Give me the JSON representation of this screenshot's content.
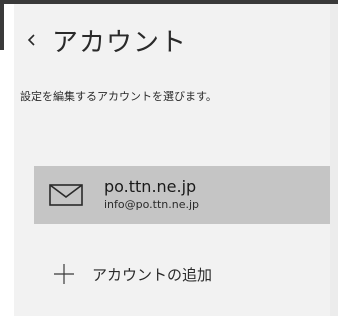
{
  "header": {
    "title": "アカウント"
  },
  "description": "設定を編集するアカウントを選びます。",
  "accounts": [
    {
      "domain": "po.ttn.ne.jp",
      "email": "info@po.ttn.ne.jp",
      "icon": "mail-icon"
    }
  ],
  "add_account": {
    "label": "アカウントの追加",
    "icon": "plus-icon"
  },
  "icons": {
    "back": "chevron-left-icon"
  },
  "colors": {
    "pane_background": "#f2f2f2",
    "selected_item": "#c5c5c5",
    "dark_frame": "#3a3a3a"
  }
}
